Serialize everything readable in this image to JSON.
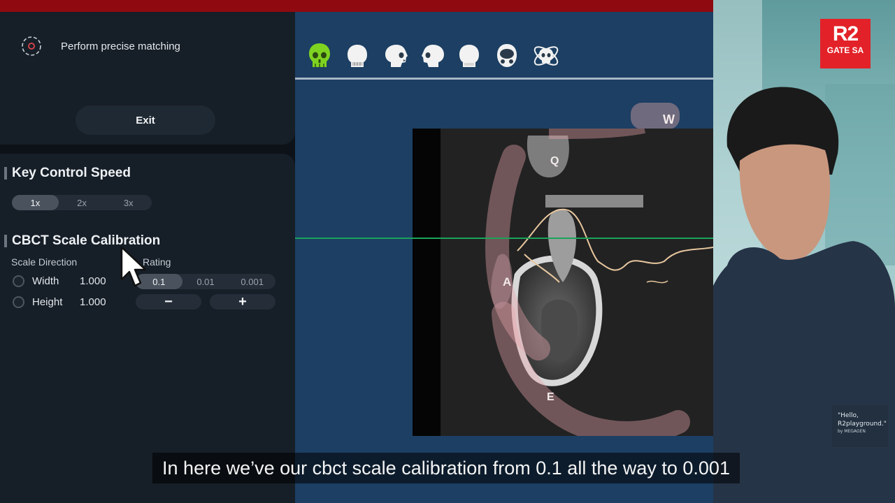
{
  "panel": {
    "precise_matching_label": "Perform precise matching",
    "exit_label": "Exit"
  },
  "key_control_speed": {
    "title": "Key Control Speed",
    "options": [
      "1x",
      "2x",
      "3x"
    ],
    "selected": "1x"
  },
  "cbct_calibration": {
    "title": "CBCT Scale Calibration",
    "scale_direction_label": "Scale Direction",
    "rating_label": "Rating",
    "width_label": "Width",
    "width_value": "1.000",
    "height_label": "Height",
    "height_value": "1.000",
    "rating_options": [
      "0.1",
      "0.01",
      "0.001"
    ],
    "selected_rating": "0.1",
    "minus_label": "−",
    "plus_label": "+"
  },
  "viewer": {
    "toolbar_icons": [
      "skull-green-icon",
      "skull-front-icon",
      "skull-left-icon",
      "skull-right-icon",
      "skull-back-icon",
      "skull-top-icon",
      "skull-3d-icon"
    ],
    "labels": {
      "w": "W",
      "q": "Q",
      "a": "A",
      "e": "E"
    }
  },
  "logo": {
    "line1": "R2",
    "line2": "GATE SA"
  },
  "shirt_text": {
    "line1": "\"Hello,",
    "line2": "R2playground.\"",
    "line3": "by MEGAGEN"
  },
  "subtitle": "In here we’ve our cbct scale calibration from 0.1 all the way to 0.001",
  "colors": {
    "accent_green": "#7ed321",
    "brand_red": "#e32128",
    "viewer_bg": "#1c3f63"
  }
}
